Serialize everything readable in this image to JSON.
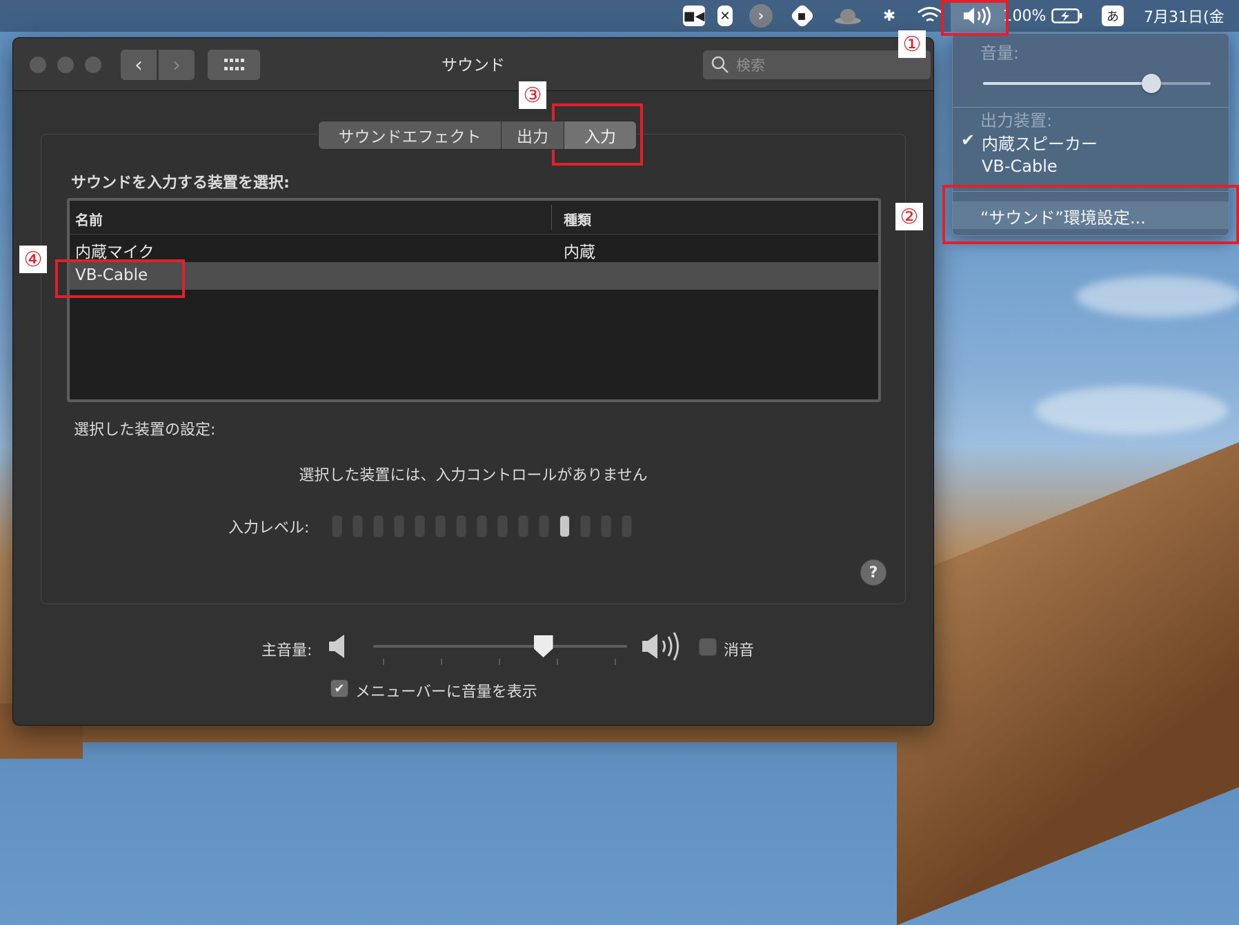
{
  "menubar": {
    "battery": "100%",
    "ime": "あ",
    "datetime": "7月31日(金"
  },
  "window": {
    "title": "サウンド",
    "search_placeholder": "検索",
    "tabs": [
      "サウンドエフェクト",
      "出力",
      "入力"
    ],
    "active_tab": "入力",
    "device_section_label": "サウンドを入力する装置を選択:",
    "table": {
      "columns": [
        "名前",
        "種類"
      ],
      "rows": [
        {
          "name": "内蔵マイク",
          "type": "内蔵"
        },
        {
          "name": "VB-Cable",
          "type": ""
        }
      ],
      "selected_row": 1
    },
    "settings_label": "選択した装置の設定:",
    "no_controls_message": "選択した装置には、入力コントロールがありません",
    "input_level_label": "入力レベル:",
    "input_level": {
      "total_bars": 15,
      "lit_bar": 12
    },
    "help_label": "?",
    "volume_label": "主音量:",
    "volume_level_fraction": 0.67,
    "mute_label": "消音",
    "mute_checked": false,
    "show_in_menubar_label": "メニューバーに音量を表示",
    "show_in_menubar_checked": true
  },
  "volume_menu": {
    "volume_label": "音量:",
    "volume_level_fraction": 0.74,
    "output_label": "出力装置:",
    "devices": [
      {
        "name": "内蔵スピーカー",
        "checked": true
      },
      {
        "name": "VB-Cable",
        "checked": false
      }
    ],
    "prefs_item": "“サウンド”環境設定..."
  },
  "annotations": [
    "①",
    "②",
    "③",
    "④"
  ],
  "colors": {
    "annotation_red": "#e0202a",
    "selection_gray": "#4e4e4e"
  }
}
